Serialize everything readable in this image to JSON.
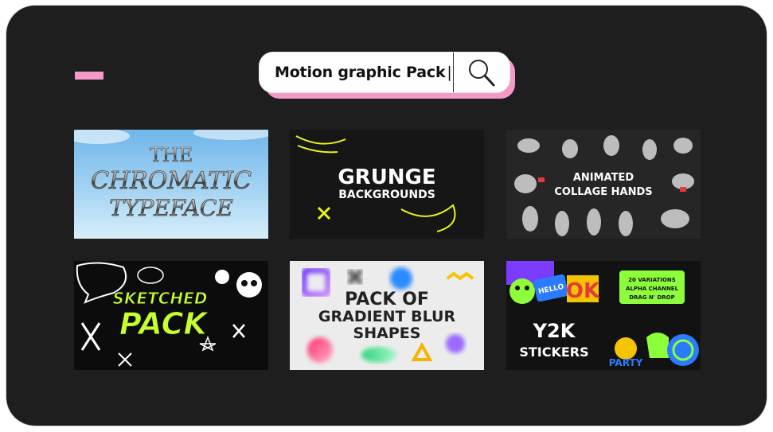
{
  "search": {
    "value": "Motion graphic Pack",
    "caret": "|"
  },
  "products": [
    {
      "title_lines": [
        "THE",
        "CHROMATIC",
        "TYPEFACE"
      ],
      "icon": "chrome-type-thumbnail"
    },
    {
      "title_lines": [
        "GRUNGE",
        "BACKGROUNDS"
      ],
      "icon": "grunge-thumbnail"
    },
    {
      "title_lines": [
        "ANIMATED",
        "COLLAGE HANDS"
      ],
      "icon": "hands-thumbnail"
    },
    {
      "title_lines": [
        "SKETCHED",
        "PACK"
      ],
      "icon": "sketch-thumbnail"
    },
    {
      "title_lines": [
        "PACK OF",
        "GRADIENT BLUR",
        "SHAPES"
      ],
      "icon": "blur-shapes-thumbnail"
    },
    {
      "title_lines": [
        "Y2K",
        "STICKERS"
      ],
      "badge_lines": [
        "20 VARIATIONS",
        "ALPHA CHANNEL",
        "DRAG N' DROP"
      ],
      "sticker_texts": [
        "HELLO",
        "OK",
        "PARTY"
      ],
      "icon": "y2k-thumbnail"
    }
  ],
  "colors": {
    "panel": "#1e1e1e",
    "accent_pink": "#f59ac8",
    "lime": "#c6ff2e"
  }
}
